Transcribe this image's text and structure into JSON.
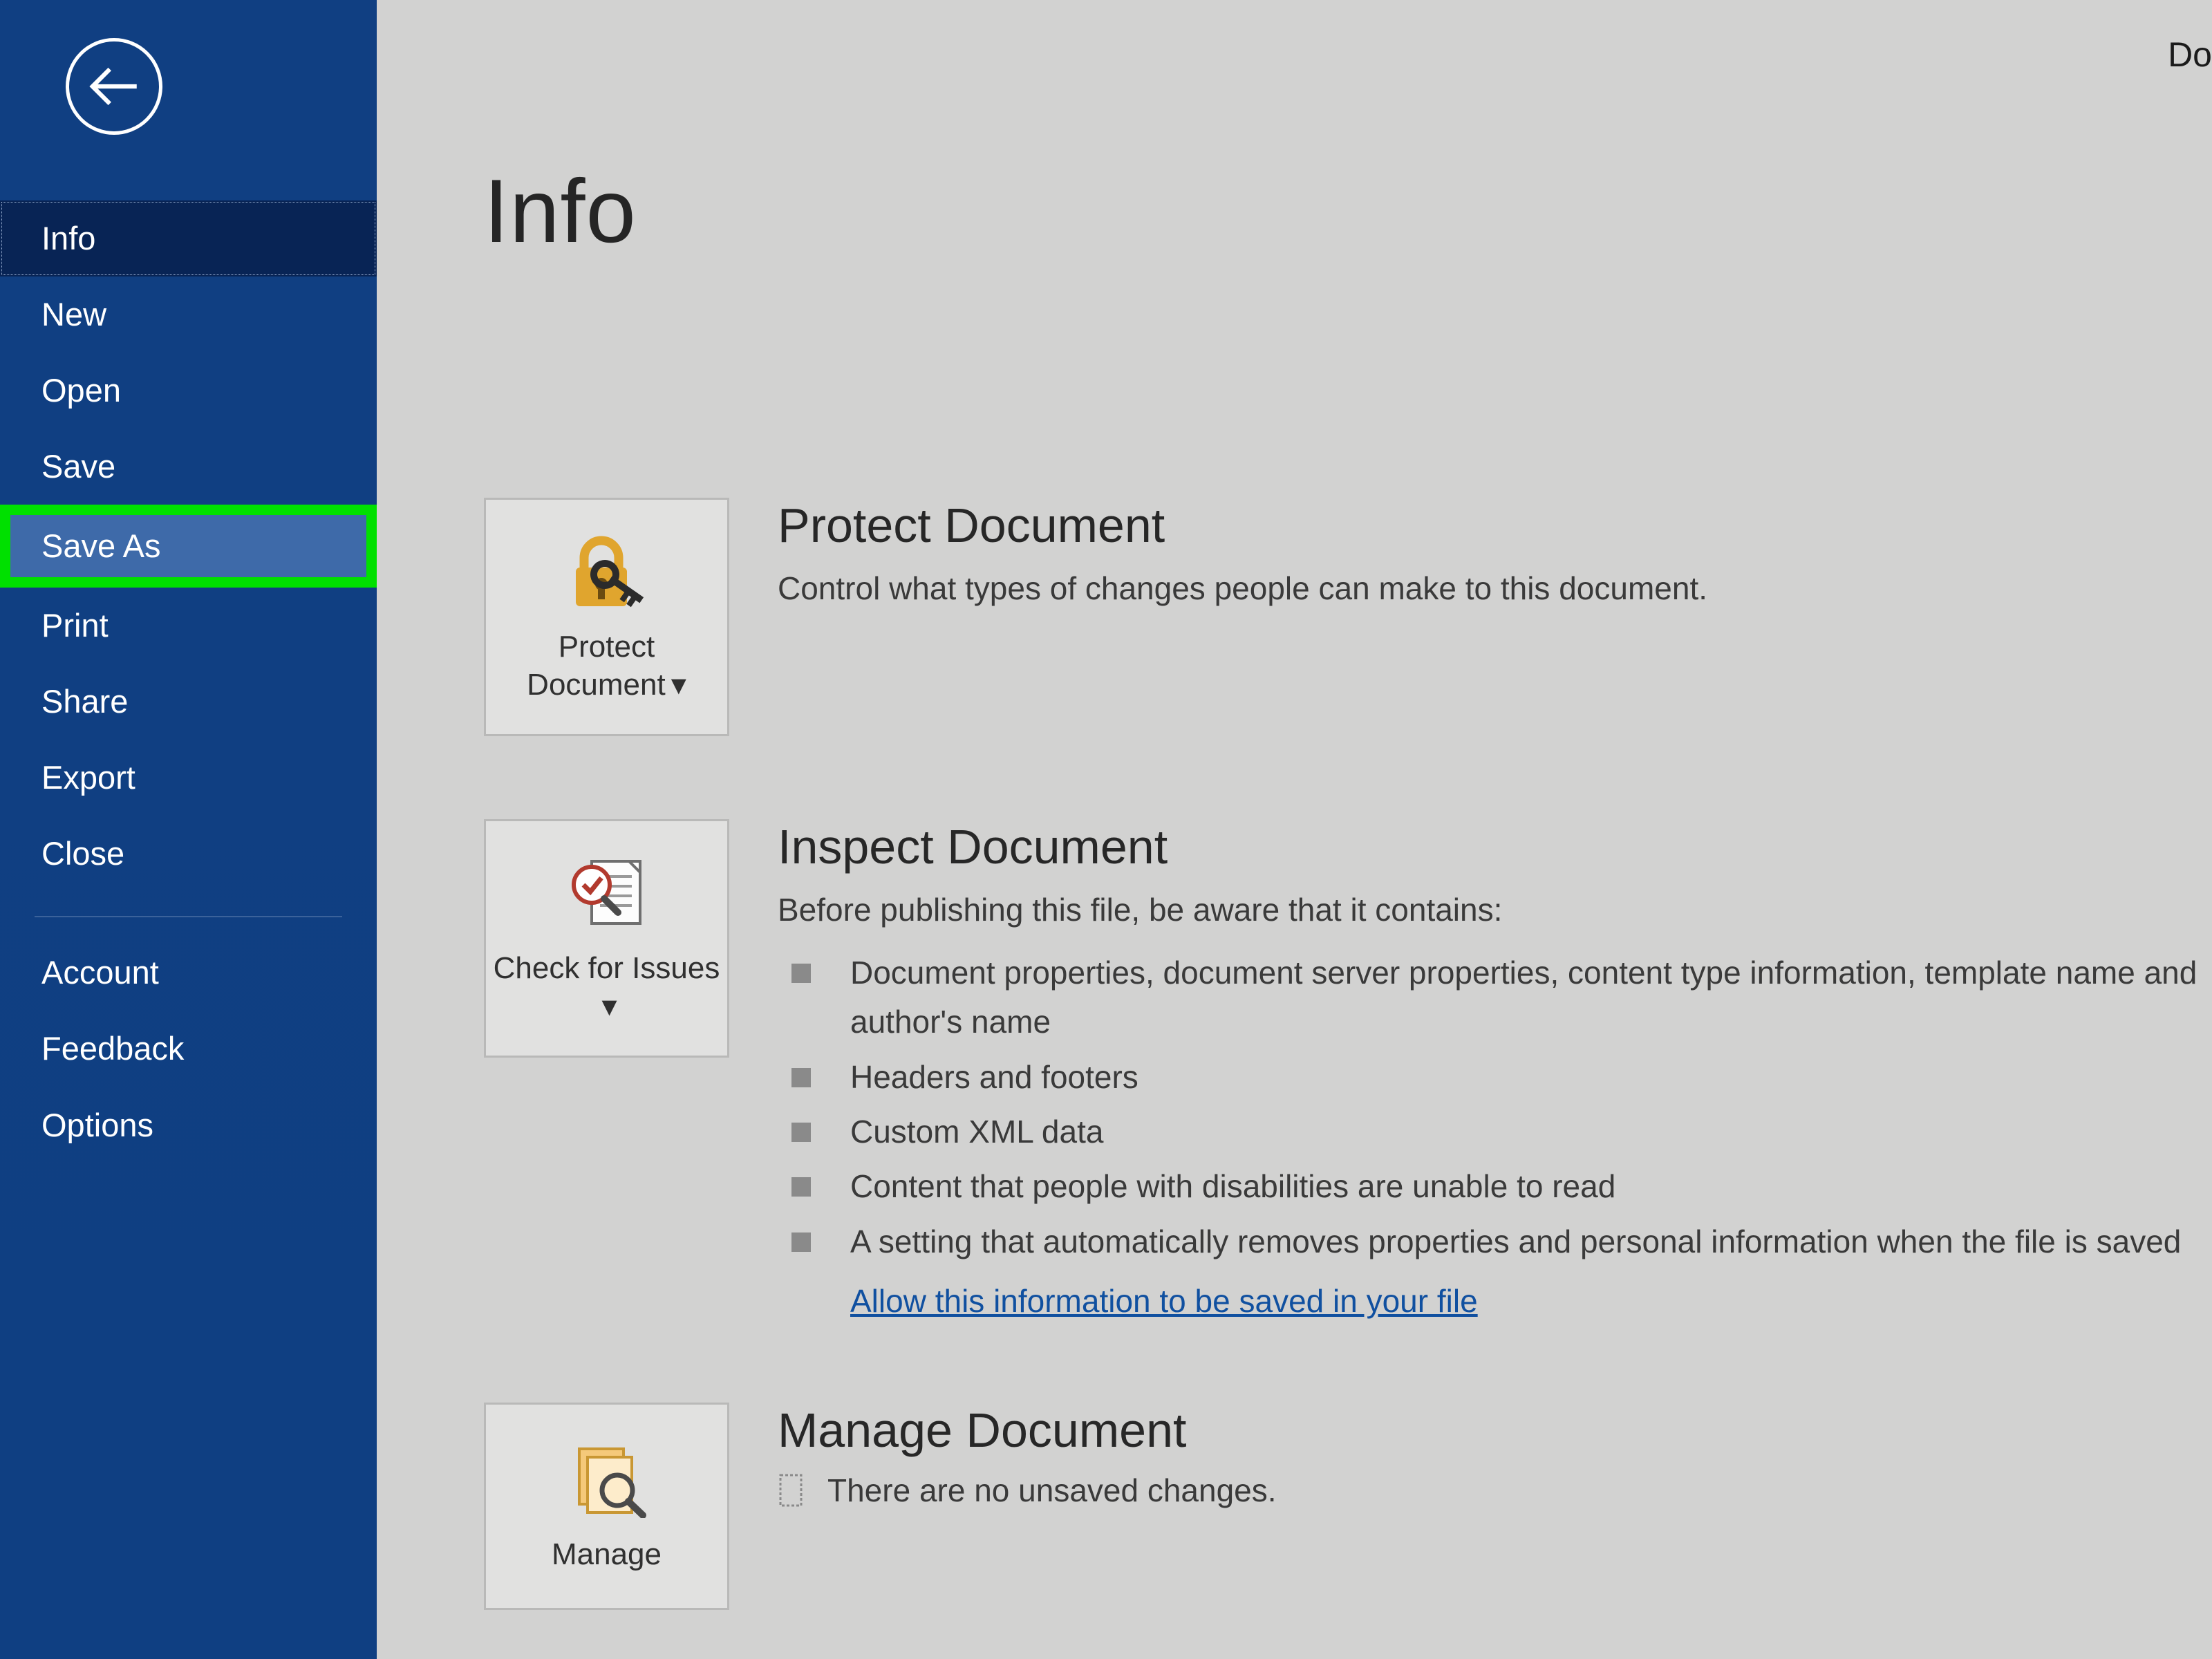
{
  "header": {
    "doc_label": "Do"
  },
  "sidebar": {
    "items": [
      {
        "label": "Info"
      },
      {
        "label": "New"
      },
      {
        "label": "Open"
      },
      {
        "label": "Save"
      },
      {
        "label": "Save As"
      },
      {
        "label": "Print"
      },
      {
        "label": "Share"
      },
      {
        "label": "Export"
      },
      {
        "label": "Close"
      }
    ],
    "footer_items": [
      {
        "label": "Account"
      },
      {
        "label": "Feedback"
      },
      {
        "label": "Options"
      }
    ]
  },
  "main": {
    "title": "Info",
    "protect": {
      "tile_label": "Protect Document",
      "heading": "Protect Document",
      "desc": "Control what types of changes people can make to this document."
    },
    "inspect": {
      "tile_label": "Check for Issues",
      "heading": "Inspect Document",
      "desc": "Before publishing this file, be aware that it contains:",
      "bullets": [
        "Document properties, document server properties, content type information, template name and author's name",
        "Headers and footers",
        "Custom XML data",
        "Content that people with disabilities are unable to read",
        "A setting that automatically removes properties and personal information when the file is saved"
      ],
      "link": "Allow this information to be saved in your file"
    },
    "manage": {
      "tile_label": "Manage",
      "heading": "Manage Document",
      "desc": "There are no unsaved changes."
    }
  }
}
